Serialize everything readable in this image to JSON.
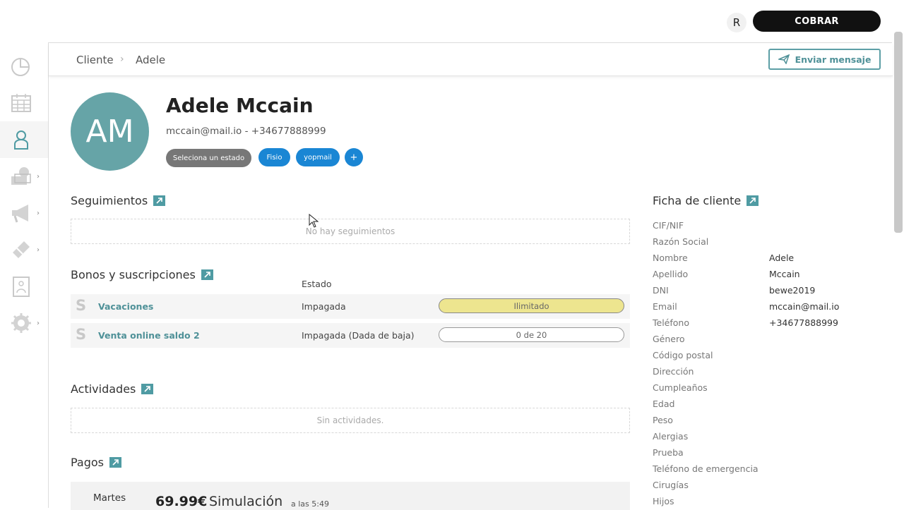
{
  "topbar": {
    "user_initial": "R",
    "cobrar_label": "COBRAR"
  },
  "breadcrumb": {
    "root": "Cliente",
    "current": "Adele"
  },
  "send_button": {
    "label": "Enviar mensaje",
    "icon": "paper-plane-icon"
  },
  "client": {
    "initials": "AM",
    "name": "Adele Mccain",
    "contact": "mccain@mail.io - +34677888999",
    "status_pill": "Seleciona un estado",
    "tags": [
      "Fisio",
      "yopmail"
    ],
    "add_tag": "+"
  },
  "seguimientos": {
    "title": "Seguimientos",
    "empty": "No hay seguimientos"
  },
  "bonos": {
    "title": "Bonos y suscripciones",
    "estado_header": "Estado",
    "rows": [
      {
        "icon": "S",
        "name": "Vacaciones",
        "state": "Impagada",
        "bar": "Ilimitado"
      },
      {
        "icon": "S",
        "name": "Venta online saldo 2",
        "state": "Impagada (Dada de baja)",
        "bar": "0 de 20"
      }
    ]
  },
  "actividades": {
    "title": "Actividades",
    "empty": "Sin actividades."
  },
  "pagos": {
    "title": "Pagos",
    "rows": [
      {
        "day": "Martes",
        "amount": "69.99€",
        "desc": "Simulación",
        "time": "a las 5:49"
      }
    ]
  },
  "ficha": {
    "title": "Ficha de cliente",
    "fields": [
      {
        "label": "CIF/NIF",
        "value": ""
      },
      {
        "label": "Razón Social",
        "value": ""
      },
      {
        "label": "Nombre",
        "value": "Adele"
      },
      {
        "label": "Apellido",
        "value": "Mccain"
      },
      {
        "label": "DNI",
        "value": "bewe2019"
      },
      {
        "label": "Email",
        "value": "mccain@mail.io"
      },
      {
        "label": "Teléfono",
        "value": "+34677888999"
      },
      {
        "label": "Género",
        "value": ""
      },
      {
        "label": "Código postal",
        "value": ""
      },
      {
        "label": "Dirección",
        "value": ""
      },
      {
        "label": "Cumpleaños",
        "value": ""
      },
      {
        "label": "Edad",
        "value": ""
      },
      {
        "label": "Peso",
        "value": ""
      },
      {
        "label": "Alergias",
        "value": ""
      },
      {
        "label": "Prueba",
        "value": ""
      },
      {
        "label": "Teléfono de emergencia",
        "value": ""
      },
      {
        "label": "Cirugías",
        "value": ""
      },
      {
        "label": "Hijos",
        "value": ""
      }
    ]
  },
  "sidebar": {
    "items": [
      {
        "icon": "dashboard-chart-icon"
      },
      {
        "icon": "calendar-icon"
      },
      {
        "icon": "user-icon"
      },
      {
        "icon": "money-icon"
      },
      {
        "icon": "megaphone-icon"
      },
      {
        "icon": "ticket-icon"
      },
      {
        "icon": "report-icon"
      },
      {
        "icon": "gear-icon"
      }
    ]
  },
  "colors": {
    "accent": "#4f9198",
    "avatar": "#66a4a7",
    "tag_blue": "#1a86d4",
    "cobrar_bg": "#111111",
    "bar_yellow": "#ede58f"
  }
}
